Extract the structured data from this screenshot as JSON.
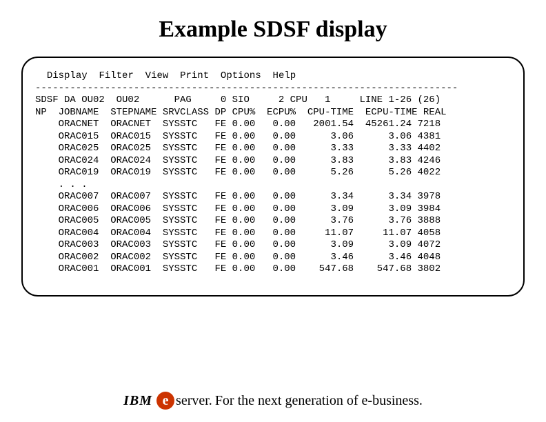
{
  "title": "Example SDSF display",
  "menu": {
    "display": "Display",
    "filter": "Filter",
    "view": "View",
    "print": "Print",
    "options": "Options",
    "help": "Help"
  },
  "separator": "-------------------------------------------------------------------------",
  "status_line": "SDSF DA OU02  OU02      PAG     0 SIO     2 CPU   1     LINE 1-26 (26)",
  "header_line": "NP  JOBNAME  STEPNAME SRVCLASS DP CPU%  ECPU%  CPU-TIME  ECPU-TIME REAL",
  "rows": [
    {
      "jobname": "ORACNET",
      "stepname": "ORACNET",
      "srvclass": "SYSSTC",
      "dp": "FE",
      "cpu": "0.00",
      "ecpu": "0.00",
      "cputime": "2001.54",
      "ecputime": "45261.24",
      "real": "7218"
    },
    {
      "jobname": "ORAC015",
      "stepname": "ORAC015",
      "srvclass": "SYSSTC",
      "dp": "FE",
      "cpu": "0.00",
      "ecpu": "0.00",
      "cputime": "3.06",
      "ecputime": "3.06",
      "real": "4381"
    },
    {
      "jobname": "ORAC025",
      "stepname": "ORAC025",
      "srvclass": "SYSSTC",
      "dp": "FE",
      "cpu": "0.00",
      "ecpu": "0.00",
      "cputime": "3.33",
      "ecputime": "3.33",
      "real": "4402"
    },
    {
      "jobname": "ORAC024",
      "stepname": "ORAC024",
      "srvclass": "SYSSTC",
      "dp": "FE",
      "cpu": "0.00",
      "ecpu": "0.00",
      "cputime": "3.83",
      "ecputime": "3.83",
      "real": "4246"
    },
    {
      "jobname": "ORAC019",
      "stepname": "ORAC019",
      "srvclass": "SYSSTC",
      "dp": "FE",
      "cpu": "0.00",
      "ecpu": "0.00",
      "cputime": "5.26",
      "ecputime": "5.26",
      "real": "4022"
    },
    {
      "ellipsis": true
    },
    {
      "jobname": "ORAC007",
      "stepname": "ORAC007",
      "srvclass": "SYSSTC",
      "dp": "FE",
      "cpu": "0.00",
      "ecpu": "0.00",
      "cputime": "3.34",
      "ecputime": "3.34",
      "real": "3978"
    },
    {
      "jobname": "ORAC006",
      "stepname": "ORAC006",
      "srvclass": "SYSSTC",
      "dp": "FE",
      "cpu": "0.00",
      "ecpu": "0.00",
      "cputime": "3.09",
      "ecputime": "3.09",
      "real": "3984"
    },
    {
      "jobname": "ORAC005",
      "stepname": "ORAC005",
      "srvclass": "SYSSTC",
      "dp": "FE",
      "cpu": "0.00",
      "ecpu": "0.00",
      "cputime": "3.76",
      "ecputime": "3.76",
      "real": "3888"
    },
    {
      "jobname": "ORAC004",
      "stepname": "ORAC004",
      "srvclass": "SYSSTC",
      "dp": "FE",
      "cpu": "0.00",
      "ecpu": "0.00",
      "cputime": "11.07",
      "ecputime": "11.07",
      "real": "4058"
    },
    {
      "jobname": "ORAC003",
      "stepname": "ORAC003",
      "srvclass": "SYSSTC",
      "dp": "FE",
      "cpu": "0.00",
      "ecpu": "0.00",
      "cputime": "3.09",
      "ecputime": "3.09",
      "real": "4072"
    },
    {
      "jobname": "ORAC002",
      "stepname": "ORAC002",
      "srvclass": "SYSSTC",
      "dp": "FE",
      "cpu": "0.00",
      "ecpu": "0.00",
      "cputime": "3.46",
      "ecputime": "3.46",
      "real": "4048"
    },
    {
      "jobname": "ORAC001",
      "stepname": "ORAC001",
      "srvclass": "SYSSTC",
      "dp": "FE",
      "cpu": "0.00",
      "ecpu": "0.00",
      "cputime": "547.68",
      "ecputime": "547.68",
      "real": "3802"
    }
  ],
  "ellipsis_text": ". . .",
  "footer": {
    "ibm": "IBM",
    "e": "e",
    "server": "server.",
    "tagline": "For the next generation of e-business."
  }
}
